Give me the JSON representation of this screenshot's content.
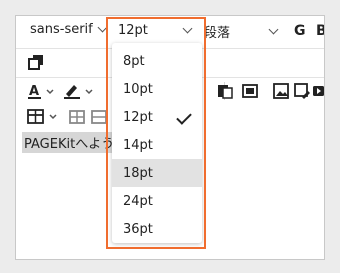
{
  "toolbar": {
    "font_family": "sans-serif",
    "font_size": "12pt",
    "block_format": "段落",
    "bold_label": "G",
    "underline_label": "B"
  },
  "editor": {
    "content": "PAGEKitへよう"
  },
  "font_size_menu": {
    "options": [
      {
        "label": "8pt",
        "selected": false,
        "highlighted": false
      },
      {
        "label": "10pt",
        "selected": false,
        "highlighted": false
      },
      {
        "label": "12pt",
        "selected": true,
        "highlighted": false
      },
      {
        "label": "14pt",
        "selected": false,
        "highlighted": false
      },
      {
        "label": "18pt",
        "selected": false,
        "highlighted": true
      },
      {
        "label": "24pt",
        "selected": false,
        "highlighted": false
      },
      {
        "label": "36pt",
        "selected": false,
        "highlighted": false
      }
    ]
  },
  "colors": {
    "focus_outline": "#f06d2f",
    "highlight": "#e2e2e2"
  }
}
